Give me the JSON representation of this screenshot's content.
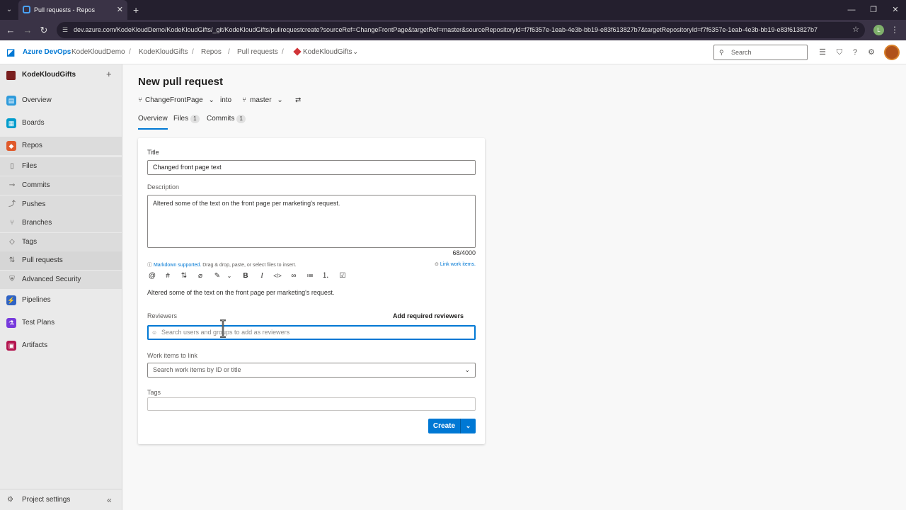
{
  "browser": {
    "tab_title": "Pull requests - Repos",
    "url": "dev.azure.com/KodeKloudDemo/KodeKloudGifts/_git/KodeKloudGifts/pullrequestcreate?sourceRef=ChangeFrontPage&targetRef=master&sourceRepositoryId=f7f6357e-1eab-4e3b-bb19-e83f613827b7&targetRepositoryId=f7f6357e-1eab-4e3b-bb19-e83f613827b7",
    "profile_initial": "L"
  },
  "header": {
    "brand": "Azure DevOps",
    "breadcrumbs": [
      "KodeKloudDemo",
      "KodeKloudGifts",
      "Repos",
      "Pull requests",
      "KodeKloudGifts"
    ],
    "search_placeholder": "Search"
  },
  "sidebar": {
    "project": "KodeKloudGifts",
    "items": [
      {
        "label": "Overview"
      },
      {
        "label": "Boards"
      },
      {
        "label": "Repos"
      },
      {
        "label": "Files"
      },
      {
        "label": "Commits"
      },
      {
        "label": "Pushes"
      },
      {
        "label": "Branches"
      },
      {
        "label": "Tags"
      },
      {
        "label": "Pull requests"
      },
      {
        "label": "Advanced Security"
      },
      {
        "label": "Pipelines"
      },
      {
        "label": "Test Plans"
      },
      {
        "label": "Artifacts"
      }
    ],
    "settings": "Project settings"
  },
  "page": {
    "title": "New pull request",
    "source_branch": "ChangeFrontPage",
    "into": "into",
    "target_branch": "master",
    "tabs": [
      {
        "label": "Overview"
      },
      {
        "label": "Files",
        "count": "1"
      },
      {
        "label": "Commits",
        "count": "1"
      }
    ]
  },
  "form": {
    "title_label": "Title",
    "title_value": "Changed front page text",
    "description_label": "Description",
    "description_value": "Altered some of the text on the front page per marketing's request.",
    "counter": "68/4000",
    "markdown_link": "Markdown supported.",
    "markdown_rest": " Drag & drop, paste, or select files to insert.",
    "link_work_items": "Link work items.",
    "preview": "Altered some of the text on the front page per marketing's request.",
    "reviewers_label": "Reviewers",
    "add_required_reviewers": "Add required reviewers",
    "reviewers_placeholder": "Search users and groups to add as reviewers",
    "work_items_label": "Work items to link",
    "work_items_placeholder": "Search work items by ID or title",
    "tags_label": "Tags",
    "create_label": "Create"
  },
  "colors": {
    "accent": "#0078d4",
    "boards": "#009ccc",
    "repos": "#e05a2b",
    "pipelines": "#2f63c4",
    "test_plans": "#773adc",
    "artifacts": "#b4154f"
  }
}
